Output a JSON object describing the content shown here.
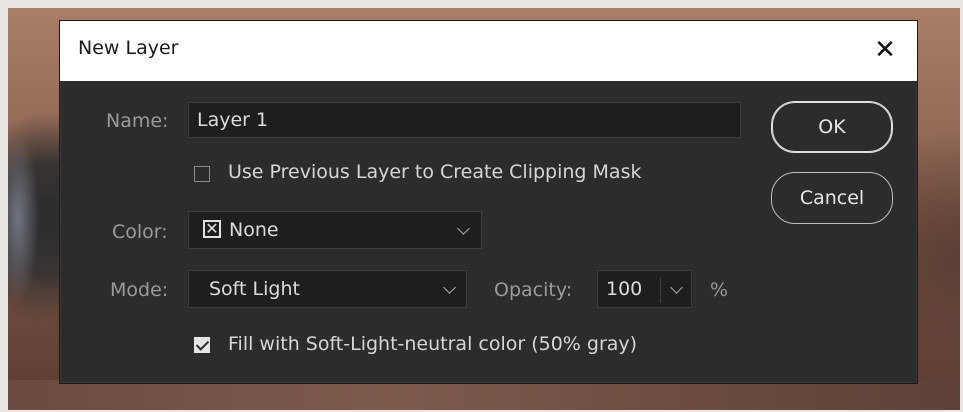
{
  "dialog": {
    "title": "New Layer",
    "close_glyph": "✕",
    "name_label": "Name:",
    "name_value": "Layer 1",
    "clip_label": "Use Previous Layer to Create Clipping Mask",
    "clip_checked": false,
    "color_label": "Color:",
    "color_value": "None",
    "color_icon": "x-box-icon",
    "mode_label": "Mode:",
    "mode_value": "Soft Light",
    "opacity_label": "Opacity:",
    "opacity_value": "100",
    "percent": "%",
    "fill_label": "Fill with Soft-Light-neutral color (50% gray)",
    "fill_checked": true,
    "ok_label": "OK",
    "cancel_label": "Cancel"
  }
}
